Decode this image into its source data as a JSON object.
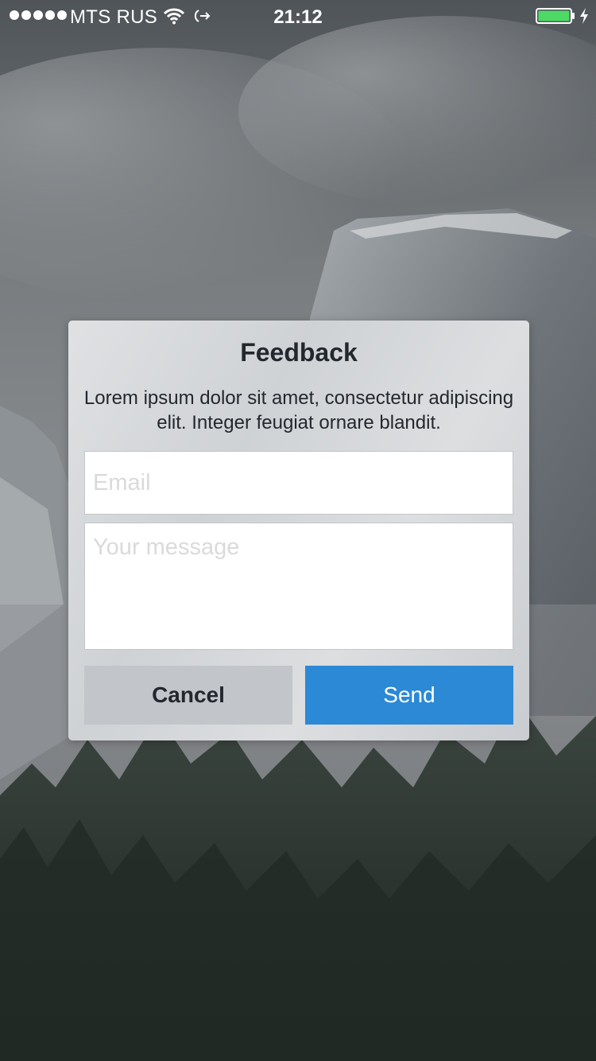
{
  "status_bar": {
    "carrier": "MTS RUS",
    "time": "21:12",
    "signal_icon": "signal-dots-icon",
    "wifi_icon": "wifi-icon",
    "activity_icon": "location-arrow-icon",
    "battery_icon": "battery-full-icon",
    "charging_icon": "charging-bolt-icon",
    "battery_color": "#4cd964"
  },
  "dialog": {
    "title": "Feedback",
    "message": "Lorem ipsum dolor sit amet, consectetur adipiscing elit. Integer feugiat ornare blandit.",
    "email_placeholder": "Email",
    "message_placeholder": "Your message",
    "cancel_label": "Cancel",
    "send_label": "Send",
    "accent_color": "#2b89d6"
  }
}
